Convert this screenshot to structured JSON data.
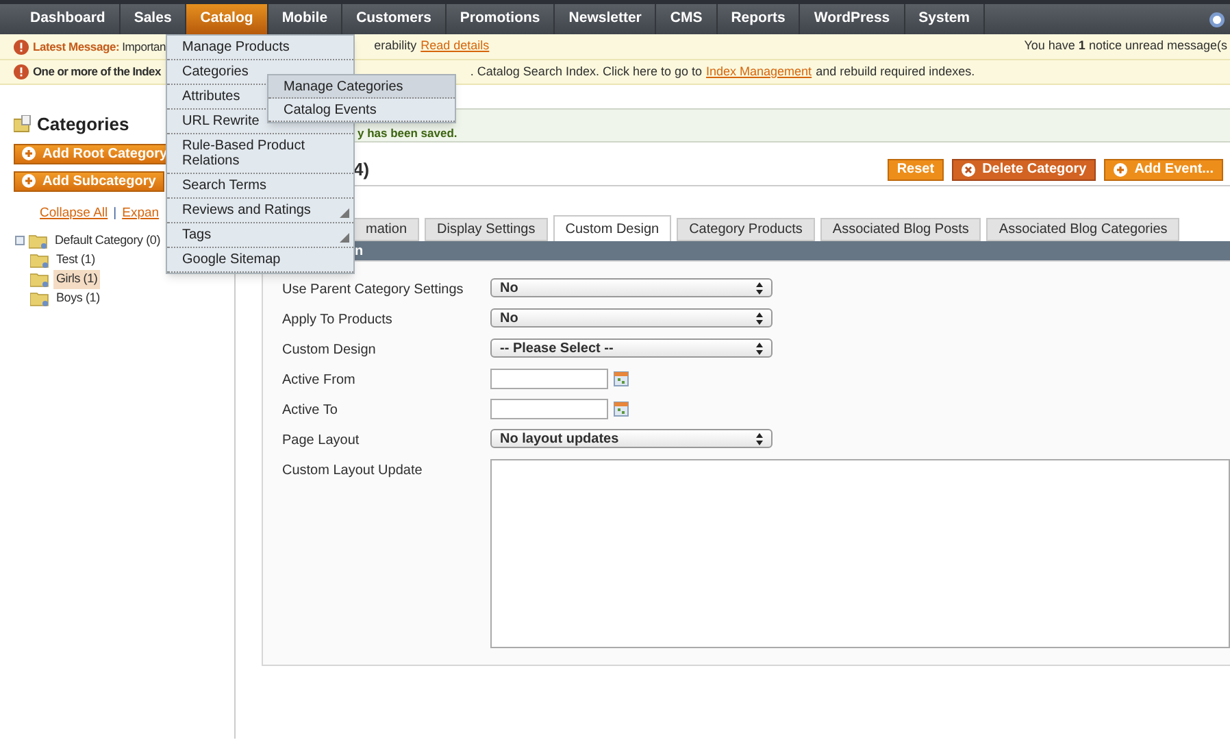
{
  "nav": {
    "items": [
      {
        "label": "Dashboard",
        "selected": false
      },
      {
        "label": "Sales",
        "selected": false
      },
      {
        "label": "Catalog",
        "selected": true
      },
      {
        "label": "Mobile",
        "selected": false
      },
      {
        "label": "Customers",
        "selected": false
      },
      {
        "label": "Promotions",
        "selected": false
      },
      {
        "label": "Newsletter",
        "selected": false
      },
      {
        "label": "CMS",
        "selected": false
      },
      {
        "label": "Reports",
        "selected": false
      },
      {
        "label": "WordPress",
        "selected": false
      },
      {
        "label": "System",
        "selected": false
      }
    ]
  },
  "menu": {
    "items": [
      {
        "label": "Manage Products",
        "arrow": false
      },
      {
        "label": "Categories",
        "arrow": false
      },
      {
        "label": "Attributes",
        "arrow": false
      },
      {
        "label": "URL Rewrite",
        "arrow": false
      },
      {
        "label": "Rule-Based Product Relations",
        "arrow": false
      },
      {
        "label": "Search Terms",
        "arrow": false
      },
      {
        "label": "Reviews and Ratings",
        "arrow": true
      },
      {
        "label": "Tags",
        "arrow": true
      },
      {
        "label": "Google Sitemap",
        "arrow": false
      }
    ],
    "submenu": [
      {
        "label": "Manage Categories",
        "selected": true
      },
      {
        "label": "Catalog Events",
        "selected": false
      }
    ]
  },
  "notice": {
    "title": "Latest Message:",
    "text_before": "Importan",
    "text_after": "erability",
    "link": "Read details",
    "right": "You have **1** notice unread message(s"
  },
  "index_notice": {
    "text_before": "One or more of the Index",
    "text_after": ". Catalog Search Index. Click here to go to",
    "link": "Index Management",
    "text_end": "and rebuild required indexes."
  },
  "success": "y has been saved.",
  "sidebar": {
    "title": "Categories",
    "buttons": [
      "Add Root Category",
      "Add Subcategory"
    ],
    "links": [
      "Collapse All",
      "Expan"
    ],
    "separator": "|",
    "tree": [
      {
        "label": "Default Category (0)",
        "selected": false,
        "children": [
          {
            "label": "Test (1)",
            "selected": false
          },
          {
            "label": "Girls (1)",
            "selected": true
          },
          {
            "label": "Boys (1)",
            "selected": false
          }
        ]
      }
    ]
  },
  "heading": "4)",
  "actions": [
    {
      "label": "Reset",
      "kind": "plain"
    },
    {
      "label": "Delete Category",
      "kind": "delete"
    },
    {
      "label": "Add Event...",
      "kind": "add"
    }
  ],
  "tabs": [
    {
      "label": "mation",
      "selected": false
    },
    {
      "label": "Display Settings",
      "selected": false
    },
    {
      "label": "Custom Design",
      "selected": true
    },
    {
      "label": "Category Products",
      "selected": false
    },
    {
      "label": "Associated Blog Posts",
      "selected": false
    },
    {
      "label": "Associated Blog Categories",
      "selected": false
    }
  ],
  "section_title": "n",
  "fields": [
    {
      "label": "Use Parent Category Settings",
      "kind": "select",
      "value": "No"
    },
    {
      "label": "Apply To Products",
      "kind": "select",
      "value": "No"
    },
    {
      "label": "Custom Design",
      "kind": "select",
      "value": "-- Please Select --"
    },
    {
      "label": "Active From",
      "kind": "date"
    },
    {
      "label": "Active To",
      "kind": "date"
    },
    {
      "label": "Page Layout",
      "kind": "select",
      "value": "No layout updates"
    },
    {
      "label": "Custom Layout Update",
      "kind": "textarea"
    }
  ]
}
